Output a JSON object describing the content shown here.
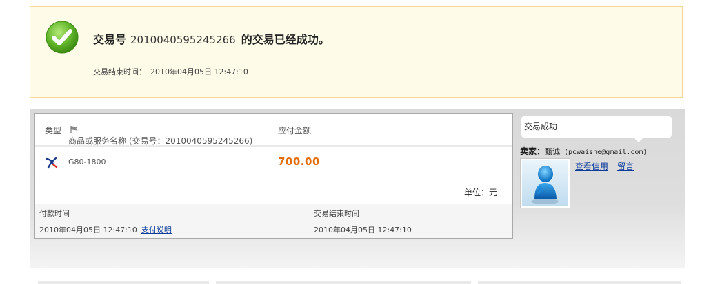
{
  "banner": {
    "title_prefix": "交易号",
    "trade_no": "2010040595245266",
    "title_suffix": "的交易已经成功。",
    "end_time_label": "交易结束时间：",
    "end_time_value": "2010年04月05日 12:47:10"
  },
  "order": {
    "headers": {
      "type": "类型",
      "name": "商品或服务名称 (交易号：2010040595245266)",
      "amount": "应付金额"
    },
    "item": {
      "name": "G80-1800",
      "price": "700.00"
    },
    "unit": "单位：元",
    "times": {
      "pay_time_label": "付款时间",
      "end_time_label": "交易结束时间",
      "pay_time_value": "2010年04月05日 12:47:10",
      "pay_note_link": "支付说明",
      "end_time_value": "2010年04月05日 12:47:10"
    }
  },
  "sidebar": {
    "status": "交易成功",
    "seller_label": "卖家：",
    "seller_name": "甄诚",
    "seller_email": "(pcwaishe@gmail.com)",
    "credit_link": "查看信用",
    "message_link": "留言"
  },
  "colors": {
    "banner_bg": "#fefce9",
    "banner_border": "#f6d792",
    "price": "#e46d0a",
    "link": "#0b3c9c",
    "success_green": "#5fb82a"
  }
}
